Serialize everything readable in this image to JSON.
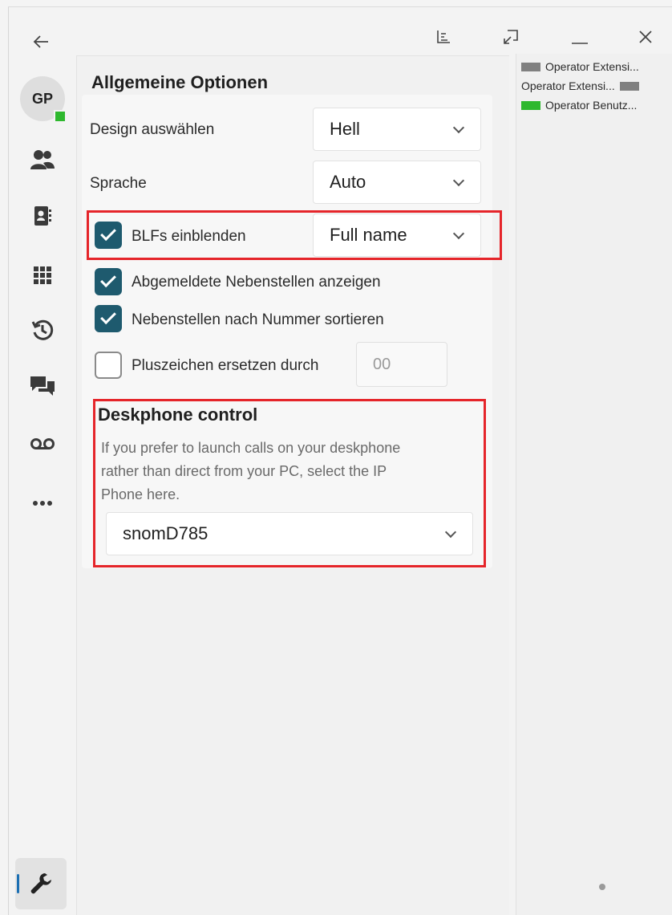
{
  "window": {
    "back_icon": "arrow-left-icon",
    "controls": [
      "chart-icon",
      "restore-icon",
      "minimize-icon",
      "close-icon"
    ]
  },
  "nav": {
    "avatar_initials": "GP",
    "presence_color": "#2eb82e",
    "items": [
      "contacts-icon",
      "address-book-icon",
      "dialpad-icon",
      "history-icon",
      "chat-icon",
      "voicemail-icon",
      "more-icon"
    ],
    "active_item": "settings-wrench-icon"
  },
  "settings": {
    "title": "Allgemeine Optionen",
    "design_label": "Design auswählen",
    "design_value": "Hell",
    "language_label": "Sprache",
    "language_value": "Auto",
    "blf_label": "BLFs einblenden",
    "blf_checked": true,
    "blf_value": "Full name",
    "logged_out_label": "Abgemeldete Nebenstellen anzeigen",
    "logged_out_checked": true,
    "sort_label": "Nebenstellen nach Nummer sortieren",
    "sort_checked": true,
    "plus_label": "Pluszeichen ersetzen durch",
    "plus_checked": false,
    "plus_value": "00"
  },
  "deskphone": {
    "title": "Deskphone control",
    "desc_line1": "If you prefer to launch calls on your deskphone",
    "desc_line2": "rather than direct from your PC, select the IP",
    "desc_line3": "Phone here.",
    "selected": "snomD785"
  },
  "right_panel": {
    "legend": [
      {
        "label": "Operator Extensi...",
        "color": "#808080"
      },
      {
        "label": "Operator Extensi...",
        "color": "#808080"
      },
      {
        "label": "Operator Benutz...",
        "color": "#2eb82e"
      }
    ]
  },
  "accent_color": "#1e5a6e",
  "highlight_color": "#e5252a"
}
